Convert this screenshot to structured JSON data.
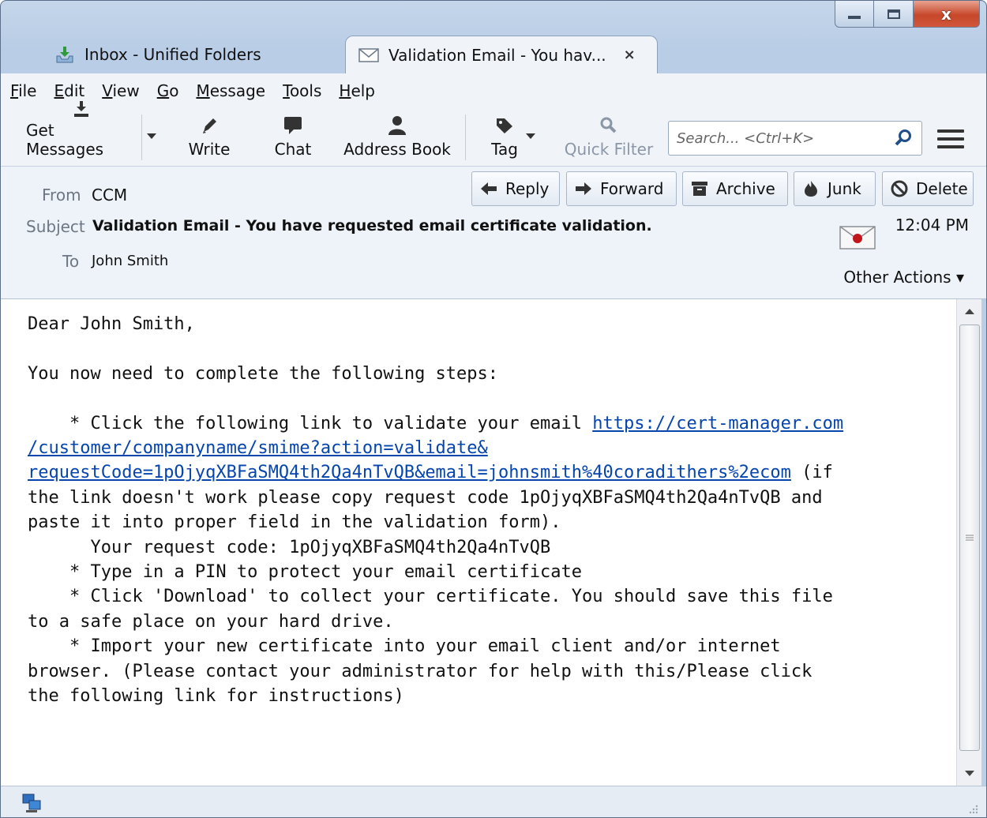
{
  "window": {
    "controls": {
      "close_glyph": "x"
    }
  },
  "tabs": [
    {
      "label": "Inbox - Unified Folders",
      "icon": "inbox-download-icon"
    },
    {
      "label": "Validation Email - You hav...",
      "icon": "envelope-icon",
      "close": "×"
    }
  ],
  "menu": [
    "File",
    "Edit",
    "View",
    "Go",
    "Message",
    "Tools",
    "Help"
  ],
  "toolbar": {
    "get_messages": "Get Messages",
    "write": "Write",
    "chat": "Chat",
    "address_book": "Address Book",
    "tag": "Tag",
    "quick_filter": "Quick Filter",
    "search_placeholder": "Search... <Ctrl+K>"
  },
  "header": {
    "from_label": "From",
    "from_value": "CCM",
    "subject_label": "Subject",
    "subject_value": "Validation Email - You have requested email certificate validation.",
    "to_label": "To",
    "to_value": "John Smith",
    "time": "12:04 PM",
    "other_actions": "Other Actions ▾",
    "actions": {
      "reply": "Reply",
      "forward": "Forward",
      "archive": "Archive",
      "junk": "Junk",
      "delete": "Delete"
    }
  },
  "body": {
    "greeting": "Dear John Smith,",
    "intro": "You now need to complete the following steps:",
    "step1_prefix": "    * Click the following link to validate your email ",
    "link_line1": "https://cert-manager.com",
    "link_line2": "/customer/companyname/smime?action=validate&",
    "link_line3": "requestCode=1pOjyqXBFaSMQ4th2Qa4nTvQB&email=johnsmith%40coradithers%2ecom",
    "step1_suffix": " (if\nthe link doesn't work please copy request code 1pOjyqXBFaSMQ4th2Qa4nTvQB and\npaste it into proper field in the validation form).",
    "request_code_line": "      Your request code: 1pOjyqXBFaSMQ4th2Qa4nTvQB",
    "step2": "    * Type in a PIN to protect your email certificate",
    "step3": "    * Click 'Download' to collect your certificate. You should save this file\nto a safe place on your hard drive.",
    "step4": "    * Import your new certificate into your email client and/or internet\nbrowser. (Please contact your administrator for help with this/Please click\nthe following link for instructions)"
  },
  "colors": {
    "link": "#0645ad",
    "close_button": "#c7472a",
    "chrome": "#b9cde6"
  }
}
